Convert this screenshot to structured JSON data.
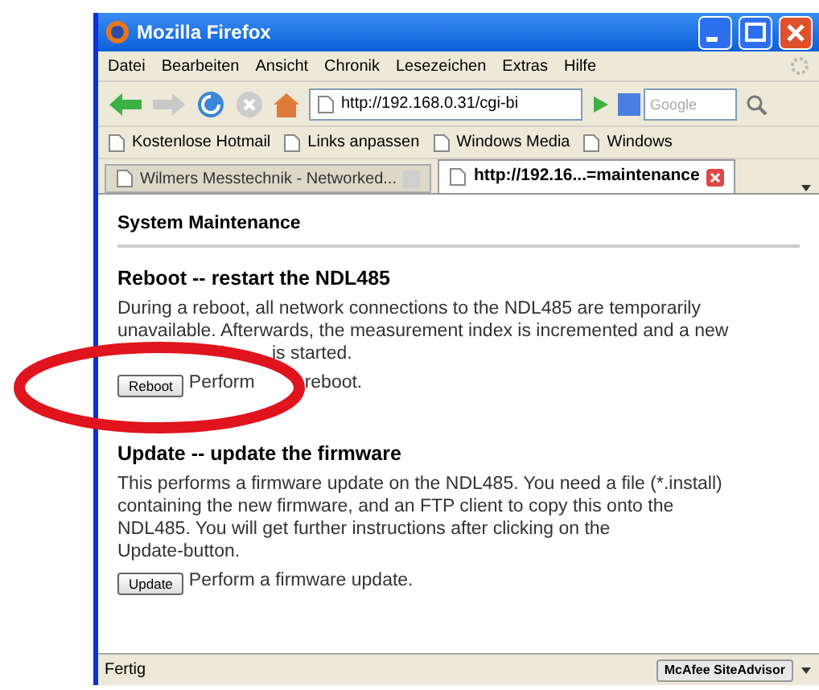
{
  "window": {
    "title": "Mozilla Firefox"
  },
  "menu": [
    "Datei",
    "Bearbeiten",
    "Ansicht",
    "Chronik",
    "Lesezeichen",
    "Extras",
    "Hilfe"
  ],
  "toolbar": {
    "url": "http://192.168.0.31/cgi-bi",
    "search_placeholder": "Google"
  },
  "bookmarks": [
    "Kostenlose Hotmail",
    "Links anpassen",
    "Windows Media",
    "Windows"
  ],
  "tabs": [
    {
      "label": "Wilmers Messtechnik - Networked...",
      "selected": false
    },
    {
      "label": "http://192.16...=maintenance",
      "selected": true
    }
  ],
  "page": {
    "heading": "System Maintenance",
    "sections": [
      {
        "title": "Reboot -- restart the NDL485",
        "lines": [
          "During a reboot, all network connections to the NDL485 are temporarily",
          "unavailable. Afterwards, the measurement index is incremented and a new"
        ],
        "partly_covered_line": "is started.",
        "button": "Reboot",
        "action_parts": [
          "Perform",
          "reboot."
        ]
      },
      {
        "title": "Update -- update the firmware",
        "lines": [
          "This performs a firmware update on the NDL485. You need a file (*.install)",
          "containing the new firmware, and an FTP client to copy this onto the",
          "NDL485. You will get further instructions after clicking on the",
          "Update-button."
        ],
        "button": "Update",
        "action_parts": [
          "Perform a firmware update."
        ]
      }
    ]
  },
  "status_bar": {
    "text": "Fertig",
    "addon": "McAfee SiteAdvisor"
  }
}
